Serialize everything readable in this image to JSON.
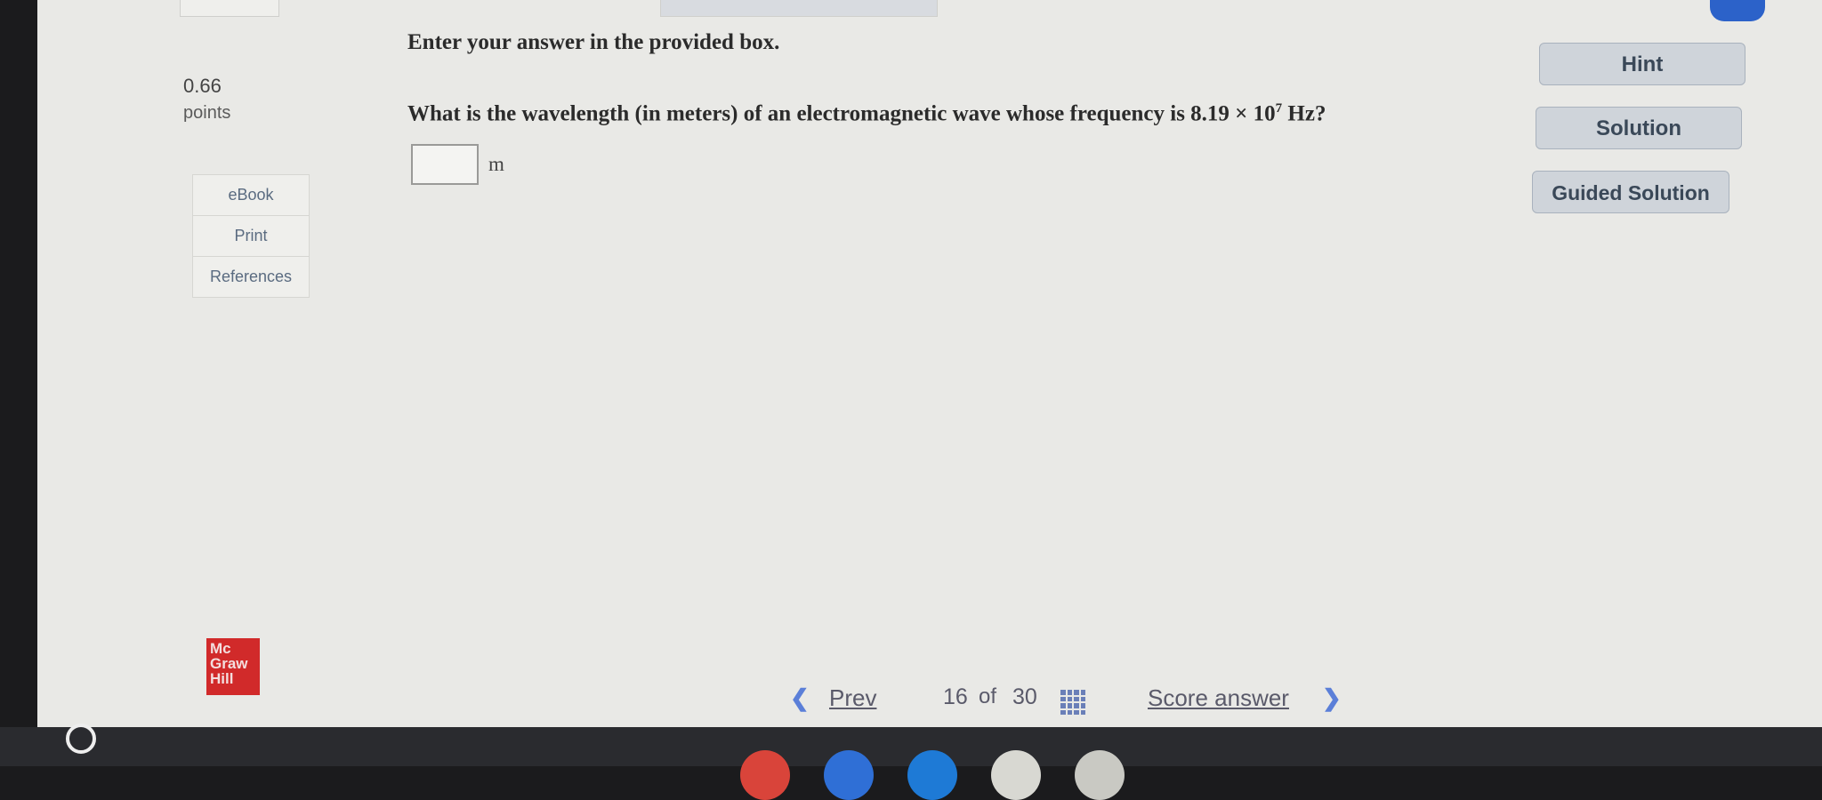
{
  "score": {
    "value": "0.66",
    "unit": "points"
  },
  "side_menu": {
    "items": [
      "eBook",
      "Print",
      "References"
    ]
  },
  "question": {
    "instruction": "Enter your answer in the provided box.",
    "text_before": "What is the wavelength (in meters) of an electromagnetic wave whose frequency is 8.19 × 10",
    "exponent": "7",
    "text_after": " Hz?",
    "answer_value": "",
    "unit": "m"
  },
  "actions": {
    "hint": "Hint",
    "solution": "Solution",
    "guided": "Guided Solution"
  },
  "logo": {
    "line1": "Mc",
    "line2": "Graw",
    "line3": "Hill"
  },
  "nav": {
    "prev": "Prev",
    "current": "16",
    "of": "of",
    "total": "30",
    "score": "Score answer"
  },
  "icons": {
    "prev": "chevron-left-icon",
    "next": "chevron-right-icon",
    "grid": "grid-icon",
    "home": "circle-home-icon"
  },
  "colors": {
    "accent": "#5b7fd8",
    "brand": "#d12a2a",
    "button_bg": "#cfd4da"
  }
}
